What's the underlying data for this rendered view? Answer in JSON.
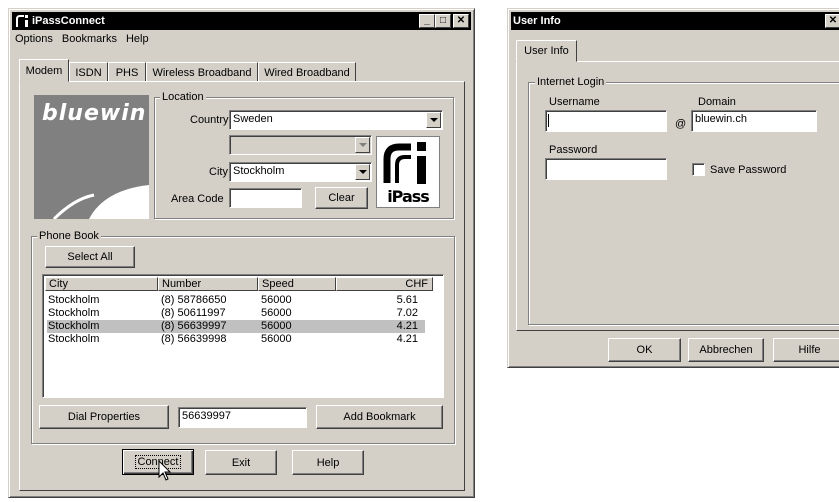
{
  "ipass": {
    "title": "iPassConnect",
    "menu": [
      "Options",
      "Bookmarks",
      "Help"
    ],
    "tabs": [
      "Modem",
      "ISDN",
      "PHS",
      "Wireless Broadband",
      "Wired Broadband"
    ],
    "active_tab": "Modem",
    "logo_text": "bluewin",
    "ipass_logo_text": "iPass",
    "location": {
      "group_label": "Location",
      "country_label": "Country",
      "country_value": "Sweden",
      "region_value": "",
      "city_label": "City",
      "city_value": "Stockholm",
      "area_code_label": "Area Code",
      "area_code_value": "",
      "clear_label": "Clear"
    },
    "phonebook": {
      "group_label": "Phone Book",
      "select_all_label": "Select All",
      "columns": [
        "City",
        "Number",
        "Speed",
        "CHF"
      ],
      "rows": [
        {
          "city": "Stockholm",
          "number": "(8) 58786650",
          "speed": "56000",
          "chf": "5.61",
          "selected": false
        },
        {
          "city": "Stockholm",
          "number": "(8) 50611997",
          "speed": "56000",
          "chf": "7.02",
          "selected": false
        },
        {
          "city": "Stockholm",
          "number": "(8) 56639997",
          "speed": "56000",
          "chf": "4.21",
          "selected": true
        },
        {
          "city": "Stockholm",
          "number": "(8) 56639998",
          "speed": "56000",
          "chf": "4.21",
          "selected": false
        }
      ],
      "dial_properties_label": "Dial Properties",
      "number_value": "56639997",
      "add_bookmark_label": "Add Bookmark"
    },
    "buttons": {
      "connect": "Connect",
      "exit": "Exit",
      "help": "Help"
    }
  },
  "userinfo": {
    "title": "User Info",
    "tab": "User Info",
    "group_label": "Internet Login",
    "username_label": "Username",
    "username_value": "",
    "at_sign": "@",
    "domain_label": "Domain",
    "domain_value": "bluewin.ch",
    "password_label": "Password",
    "password_value": "",
    "save_password_label": "Save Password",
    "save_password_checked": false,
    "buttons": {
      "ok": "OK",
      "cancel": "Abbrechen",
      "help": "Hilfe"
    }
  }
}
